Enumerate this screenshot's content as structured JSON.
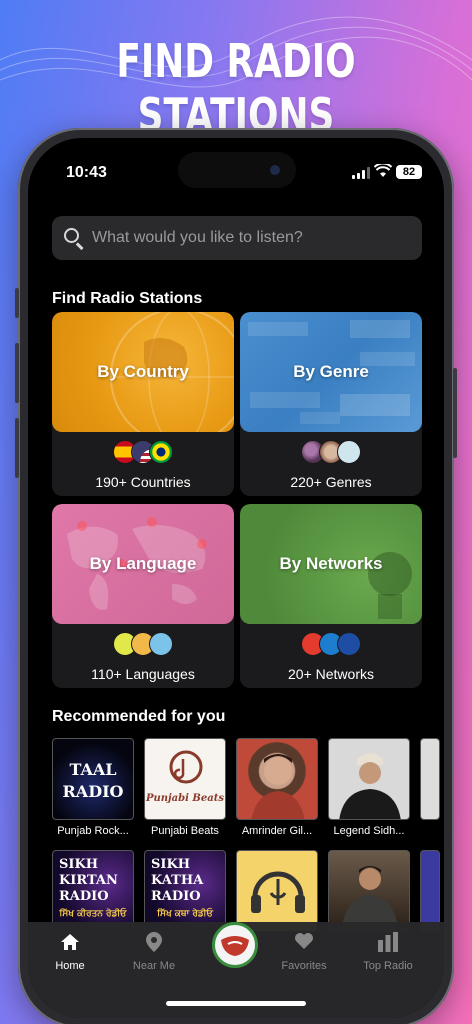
{
  "promo": {
    "title": "FIND RADIO STATIONS"
  },
  "status": {
    "time": "10:43",
    "battery": "82"
  },
  "search": {
    "placeholder": "What would you like to listen?"
  },
  "find_section": {
    "title": "Find Radio Stations",
    "cards": [
      {
        "label": "By Country",
        "count": "190+ Countries",
        "color": "#f0a21a"
      },
      {
        "label": "By Genre",
        "count": "220+ Genres",
        "color": "#3a86c8"
      },
      {
        "label": "By Language",
        "count": "110+ Languages",
        "color": "#d76fa0"
      },
      {
        "label": "By Networks",
        "count": "20+ Networks",
        "color": "#5f9a45"
      }
    ]
  },
  "recommended": {
    "title": "Recommended for you",
    "row1": [
      {
        "label": "Punjab Rock...",
        "thumb_text": "TAAL RADIO"
      },
      {
        "label": "Punjabi Beats",
        "thumb_text": "Punjabi Beats"
      },
      {
        "label": "Amrinder Gil...",
        "thumb_text": ""
      },
      {
        "label": "Legend Sidh...",
        "thumb_text": ""
      }
    ],
    "row2": [
      {
        "thumb_text": "SIKH KIRTAN RADIO",
        "sub": "ਸਿੱਖ ਕੀਰਤਨ ਰੇਡੀਓ"
      },
      {
        "thumb_text": "SIKH KATHA RADIO",
        "sub": "ਸਿੱਖ ਕਥਾ ਰੇਡੀਓ"
      },
      {
        "thumb_text": ""
      },
      {
        "thumb_text": ""
      }
    ]
  },
  "tabbar": {
    "items": [
      {
        "label": "Home",
        "icon": "home-icon"
      },
      {
        "label": "Near Me",
        "icon": "location-pin-icon"
      },
      {
        "label": "Favorites",
        "icon": "heart-icon"
      },
      {
        "label": "Top Radio",
        "icon": "bar-chart-icon"
      }
    ]
  }
}
